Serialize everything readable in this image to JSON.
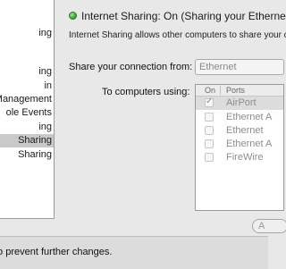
{
  "sidebar": {
    "items": [
      {
        "label": "ing"
      },
      {
        "label": "ing"
      },
      {
        "label": "in"
      },
      {
        "label": "Management"
      },
      {
        "label": "ole Events"
      },
      {
        "label": "ing"
      },
      {
        "label": "Sharing"
      },
      {
        "label": "Sharing"
      }
    ],
    "selected_index": 6
  },
  "status": {
    "title": "Internet Sharing: On (Sharing your Ethernet",
    "indicator_color": "#2f9b2f"
  },
  "description": "Internet Sharing allows other computers to share your c",
  "share_from": {
    "label": "Share your connection from:",
    "value": "Ethernet"
  },
  "to_computers": {
    "label": "To computers using:",
    "columns": [
      "On",
      "Ports"
    ],
    "rows": [
      {
        "port": "AirPort",
        "checked": true
      },
      {
        "port": "Ethernet A",
        "checked": false
      },
      {
        "port": "Ethernet",
        "checked": false
      },
      {
        "port": "Ethernet A",
        "checked": false
      },
      {
        "port": "FireWire",
        "checked": false
      }
    ]
  },
  "advanced_button": {
    "label": "A"
  },
  "bottom": {
    "lock_text": "to prevent further changes."
  }
}
